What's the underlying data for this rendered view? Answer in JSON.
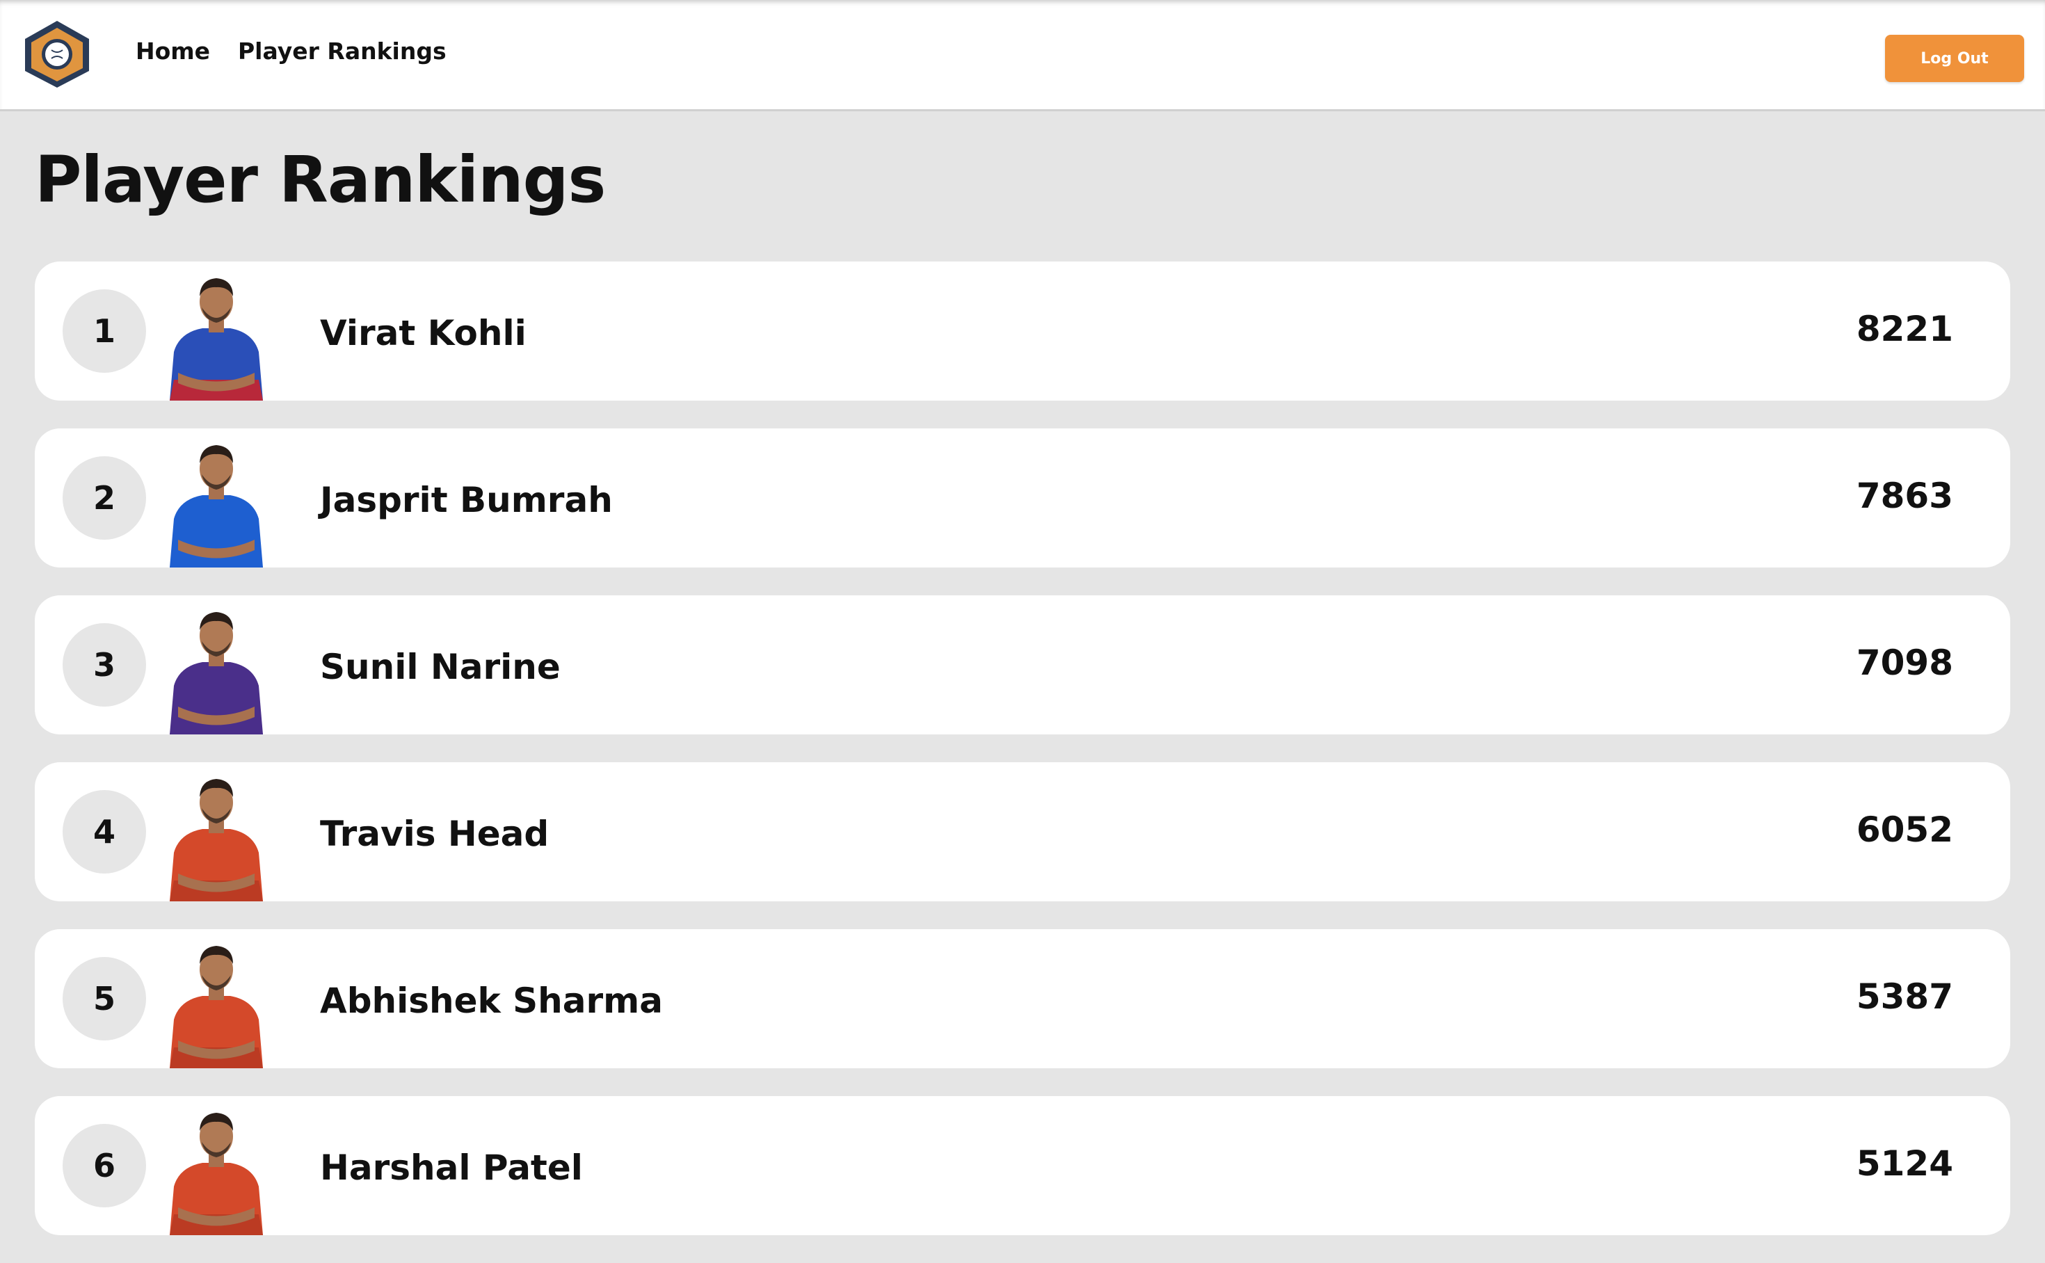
{
  "nav": {
    "logo_icon": "cricket-ball-badge-icon",
    "home_label": "Home",
    "rankings_label": "Player Rankings",
    "logout_label": "Log Out"
  },
  "page": {
    "title": "Player Rankings"
  },
  "colors": {
    "accent": "#f0923a",
    "page_bg": "#e5e5e5",
    "card_bg": "#ffffff",
    "badge_bg": "#e6e6e6",
    "logo_fill": "#e0953f",
    "logo_stroke": "#2a3b57"
  },
  "players": [
    {
      "rank": "1",
      "name": "Virat Kohli",
      "score": "8221",
      "jersey": "#2a4fb8",
      "jersey_lower": "#c8232c"
    },
    {
      "rank": "2",
      "name": "Jasprit Bumrah",
      "score": "7863",
      "jersey": "#1e5fd0",
      "jersey_lower": "#1e5fd0"
    },
    {
      "rank": "3",
      "name": "Sunil Narine",
      "score": "7098",
      "jersey": "#4a2f8a",
      "jersey_lower": "#4a2f8a"
    },
    {
      "rank": "4",
      "name": "Travis Head",
      "score": "6052",
      "jersey": "#d4492a",
      "jersey_lower": "#b83a22"
    },
    {
      "rank": "5",
      "name": "Abhishek Sharma",
      "score": "5387",
      "jersey": "#d4492a",
      "jersey_lower": "#b83a22"
    },
    {
      "rank": "6",
      "name": "Harshal Patel",
      "score": "5124",
      "jersey": "#d4492a",
      "jersey_lower": "#b83a22"
    }
  ]
}
